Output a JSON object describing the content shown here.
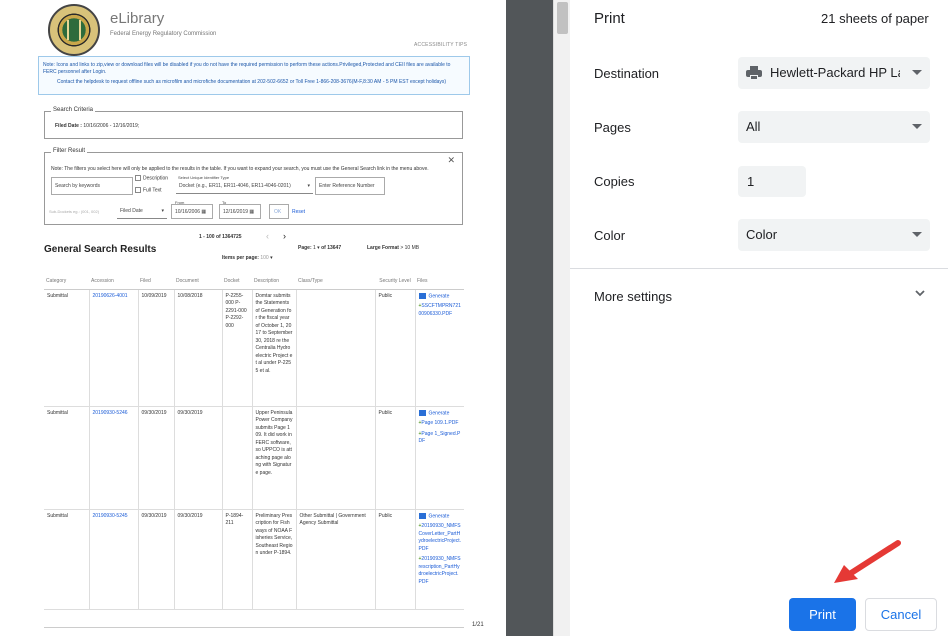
{
  "preview": {
    "site_title": "eLibrary",
    "site_subtitle": "Federal Energy Regulatory Commission",
    "accessibility_link": "ACCESSIBILITY TIPS",
    "notice_line1": "Note: Icons and links to zip,view or download files will be disabled if you do not have the required permission to perform these actions.Privileged,Protected and CEII files are available to FERC personnel after Login.",
    "notice_line2": "Contact the helpdesk to request offline such as microfilm and microfiche documentation at 202-502-6652 or Toll Free 1-866-208-3676(M-F,8:30 AM - 5 PM EST except holidays)",
    "search_criteria": {
      "legend": "Search Criteria",
      "filed_date_label": "Filed Date :",
      "filed_date_value": "10/16/2006 - 12/16/2019;"
    },
    "filter": {
      "legend": "Filter Result",
      "close": "✕",
      "note": "Note: The filters you select here will only be applied to the results in the table. If you want to expand your search, you must use the General Search link in the menu above.",
      "keyword_placeholder": "Search by keywords",
      "description_label": "Description",
      "fulltext_label": "Full Text",
      "identifier_label": "Select Unique Identifier Type",
      "identifier_value": "Docket (e.g., ER11, ER11-4046, ER11-4046-0201)",
      "reference_placeholder": "Enter Reference Number",
      "subdocket_placeholder": "Sub-Dockets eg.: (001, 002)",
      "date_type": "Filed Date",
      "from_label": "From",
      "from_value": "10/16/2006",
      "to_label": "To",
      "to_value": "12/16/2019",
      "ok": "OK",
      "reset": "Reset"
    },
    "results": {
      "heading": "General Search Results",
      "range": "1 - 100 of 1364725",
      "prev": "‹",
      "next": "›",
      "items_per_page_label": "Items per page:",
      "items_per_page_value": "100",
      "page_label": "Page:",
      "page_value": "1",
      "page_of": "of 13647",
      "large_format": "Large Format",
      "large_format_value": "> 10 MB",
      "columns": [
        "Category",
        "Accession",
        "Filed",
        "Document",
        "Docket",
        "Description",
        "Class/Type",
        "Security Level",
        "Files"
      ],
      "rows": [
        {
          "category": "Submittal",
          "accession": "20190626-4001",
          "filed": "10/09/2019",
          "document": "10/08/2018",
          "docket": "P-2255-000 P-2291-000 P-2292-000",
          "description": "Domtar submits the Statements of Generation for the fiscal year of October 1, 2017 to September 30, 2018 re the Centralia Hydroelectric Project et al under P-2255 et al.",
          "class_type": "",
          "security": "Public",
          "files": [
            "Generate",
            "SSCFTMPRN721 00906330.PDF"
          ]
        },
        {
          "category": "Submittal",
          "accession": "20190930-5246",
          "filed": "09/30/2019",
          "document": "09/30/2019",
          "docket": "",
          "description": "Upper Peninsula Power Company submits Page 109. It did work in FERC software, so UPPCO is attaching page along with Signature page.",
          "class_type": "",
          "security": "Public",
          "files": [
            "Generate",
            "Page 109.1.PDF",
            "Page 1_Signed.PDF"
          ]
        },
        {
          "category": "Submittal",
          "accession": "20190930-5245",
          "filed": "09/30/2019",
          "document": "09/30/2019",
          "docket": "P-1894-211",
          "description": "Preliminary Prescription for Fishways of NOAA Fisheries Service, Southeast Region under P-1894.",
          "class_type": "Other Submittal | Government Agency Submittal",
          "security": "Public",
          "files": [
            "Generate",
            "20190930_NMFS CoverLetter_PartHydroelectricProject.PDF",
            "20190930_NMFS rescription_PartHydroelectricProject.PDF"
          ]
        }
      ]
    },
    "page_number": "1/21"
  },
  "panel": {
    "title": "Print",
    "sheets": "21 sheets of paper",
    "destination_label": "Destination",
    "destination_value": "Hewlett-Packard HP LaserJet",
    "pages_label": "Pages",
    "pages_value": "All",
    "copies_label": "Copies",
    "copies_value": "1",
    "color_label": "Color",
    "color_value": "Color",
    "more_settings": "More settings",
    "print_button": "Print",
    "cancel_button": "Cancel"
  },
  "colors": {
    "accent": "#1a73e8",
    "arrow": "#e53935",
    "preview_bg": "#525659"
  }
}
